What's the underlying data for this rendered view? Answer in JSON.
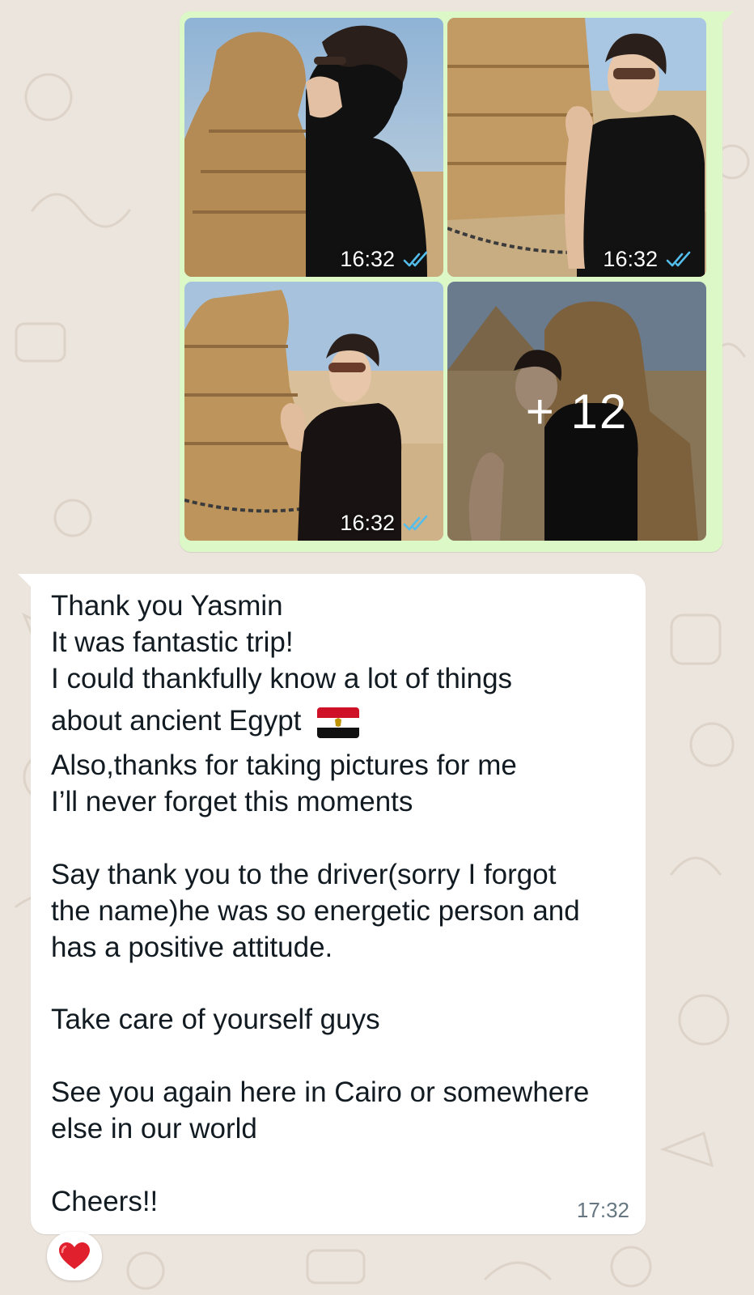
{
  "album": {
    "photos": [
      {
        "time": "16:32",
        "status": "read-double-check-icon"
      },
      {
        "time": "16:32",
        "status": "read-double-check-icon"
      },
      {
        "time": "16:32",
        "status": "read-double-check-icon"
      },
      {
        "more_count": "+ 12"
      }
    ],
    "status_color": "#53bdeb",
    "bubble_color": "#dcf8c6"
  },
  "message": {
    "lines": [
      "Thank you Yasmin",
      "It was fantastic trip!",
      "I could thankfully know a lot of things",
      "about ancient Egypt",
      "Also,thanks for taking pictures for me",
      "I’ll never forget this moments",
      "Say thank you to the driver(sorry I forgot",
      "the name)he was so energetic person and",
      "has a positive attitude.",
      "Take care of yourself guys",
      "See you again here in Cairo or somewhere",
      "else in our world",
      "Cheers!!"
    ],
    "emoji": "egypt-flag-emoji",
    "time": "17:32"
  },
  "reaction": {
    "emoji": "❤️",
    "icon": "red-heart-icon"
  },
  "colors": {
    "chat_background": "#ece5dd",
    "incoming_bubble": "#ffffff",
    "timestamp_gray": "#667781"
  }
}
